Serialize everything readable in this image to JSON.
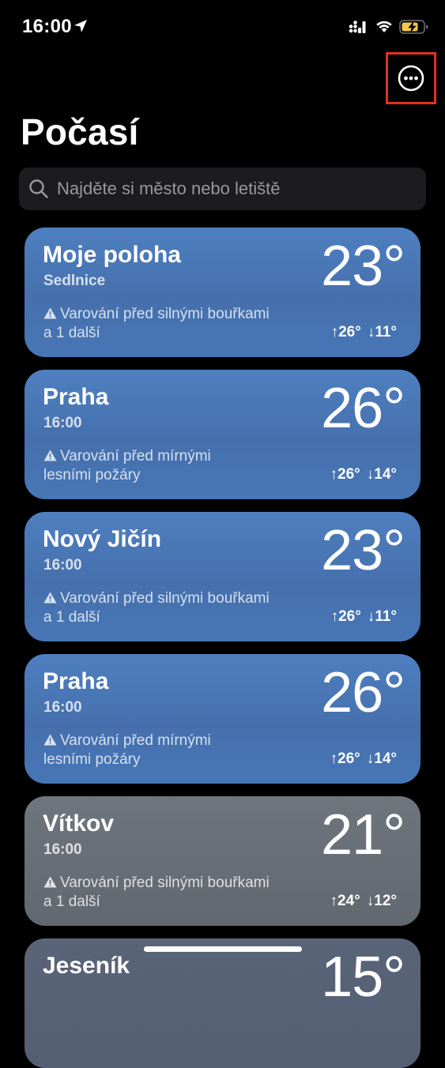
{
  "status_bar": {
    "time": "16:00"
  },
  "header": {
    "title": "Počasí"
  },
  "search": {
    "placeholder": "Najděte si město nebo letiště"
  },
  "cities": [
    {
      "name": "Moje poloha",
      "subtitle": "Sedlnice",
      "temp": "23°",
      "alert_line1": "Varování před silnými bouřkami",
      "alert_line2": "a 1 další",
      "high": "↑26°",
      "low": "↓11°"
    },
    {
      "name": "Praha",
      "subtitle": "16:00",
      "temp": "26°",
      "alert_line1": "Varování před mírnými",
      "alert_line2": "lesními požáry",
      "high": "↑26°",
      "low": "↓14°"
    },
    {
      "name": "Nový Jičín",
      "subtitle": "16:00",
      "temp": "23°",
      "alert_line1": "Varování před silnými bouřkami",
      "alert_line2": "a 1 další",
      "high": "↑26°",
      "low": "↓11°"
    },
    {
      "name": "Praha",
      "subtitle": "16:00",
      "temp": "26°",
      "alert_line1": "Varování před mírnými",
      "alert_line2": "lesními požáry",
      "high": "↑26°",
      "low": "↓14°"
    },
    {
      "name": "Vítkov",
      "subtitle": "16:00",
      "temp": "21°",
      "alert_line1": "Varování před silnými bouřkami",
      "alert_line2": "a 1 další",
      "high": "↑24°",
      "low": "↓12°"
    },
    {
      "name": "Jeseník",
      "temp": "15°"
    }
  ],
  "colors": {
    "card_blue": "#4a78b8",
    "card_gray": "#686e76",
    "highlight_border": "#e0321f",
    "battery_charging": "#f2c94c"
  },
  "icons": {
    "location": "location-arrow-icon",
    "signal": "cellular-signal-icon",
    "wifi": "wifi-icon",
    "battery": "battery-charging-icon",
    "more": "ellipsis-circle-icon",
    "search": "magnifying-glass-icon",
    "alert": "warning-triangle-icon"
  }
}
